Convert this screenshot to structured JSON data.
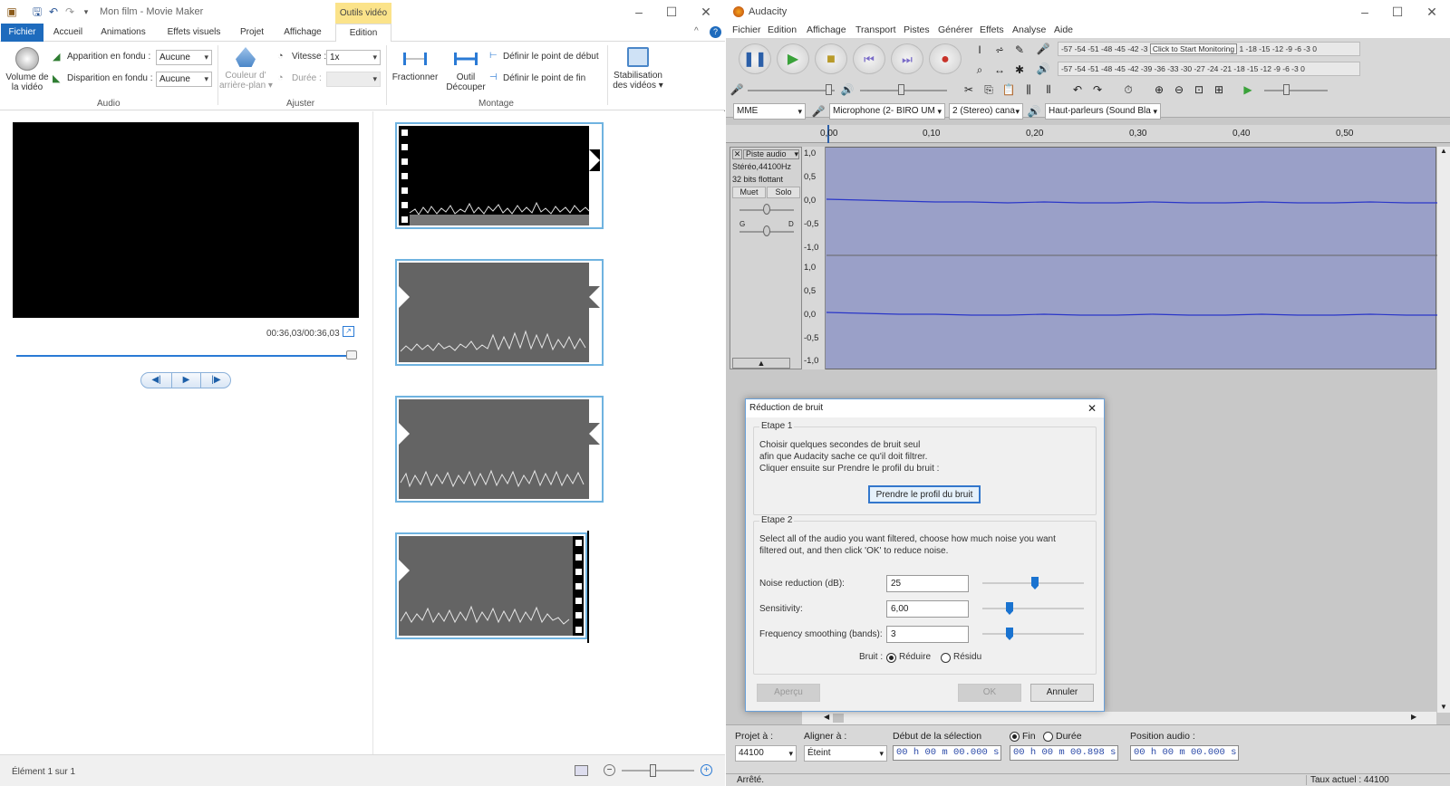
{
  "moviemaker": {
    "title": "Mon film - Movie Maker",
    "contextual_tab": "Outils vidéo",
    "tabs": [
      "Fichier",
      "Accueil",
      "Animations",
      "Effets visuels",
      "Projet",
      "Affichage",
      "Edition"
    ],
    "ribbon": {
      "audio": {
        "group": "Audio",
        "volume_label_1": "Volume de",
        "volume_label_2": "la vidéo",
        "fade_in_label": "Apparition en fondu :",
        "fade_in_value": "Aucune",
        "fade_out_label": "Disparition en fondu :",
        "fade_out_value": "Aucune"
      },
      "adjust": {
        "group": "Ajuster",
        "bgcolor_1": "Couleur d'",
        "bgcolor_2": "arrière-plan ▾",
        "speed_label": "Vitesse :",
        "speed_value": "1x",
        "duration_label": "Durée :"
      },
      "montage": {
        "group": "Montage",
        "split": "Fractionner",
        "trim_1": "Outil",
        "trim_2": "Découper",
        "set_start": "Définir le point de début",
        "set_end": "Définir le point de fin"
      },
      "stab_1": "Stabilisation",
      "stab_2": "des vidéos ▾"
    },
    "timecode": "00:36,03/00:36,03",
    "status": "Élément 1 sur 1"
  },
  "audacity": {
    "title": "Audacity",
    "menu": [
      "Fichier",
      "Edition",
      "Affichage",
      "Transport",
      "Pistes",
      "Générer",
      "Effets",
      "Analyse",
      "Aide"
    ],
    "meter_rec": "-57 -54 -51 -48 -45 -42 -3",
    "meter_monitor": "Click to Start Monitoring",
    "meter_rec_tail": "1 -18 -15 -12  -9  -6  -3  0",
    "meter_play": "-57 -54 -51 -48 -45 -42 -39 -36 -33 -30 -27 -24 -21 -18 -15 -12  -9  -6  -3  0",
    "host": "MME",
    "mic": "Microphone (2- BIRO UM",
    "channels": "2 (Stereo) cana",
    "speakers": "Haut-parleurs (Sound Bla",
    "ruler": [
      "0,00",
      "0,10",
      "0,20",
      "0,30",
      "0,40",
      "0,50"
    ],
    "track": {
      "name": "Piste audio",
      "info1": "Stéréo,44100Hz",
      "info2": "32 bits flottant",
      "mute": "Muet",
      "solo": "Solo",
      "gain_left": "G",
      "gain_right": "D"
    },
    "yaxis": [
      "1,0",
      "0,5",
      "0,0",
      "-0,5",
      "-1,0"
    ],
    "selection": {
      "rate_label": "Projet à :",
      "rate": "44100",
      "snap_label": "Aligner à :",
      "snap": "Éteint",
      "start_label": "Début de la sélection",
      "start": "00 h 00 m 00.000 s",
      "end_label": "Fin",
      "dur_label": "Durée",
      "end": "00 h 00 m 00.898 s",
      "pos_label": "Position audio :",
      "pos": "00 h 00 m 00.000 s"
    },
    "status_left": "Arrêté.",
    "status_right": "Taux actuel : 44100"
  },
  "dialog": {
    "title": "Réduction de bruit",
    "step1": "Etape 1",
    "step1_text_1": "Choisir quelques secondes de bruit seul",
    "step1_text_2": "afin que Audacity sache ce qu'il doit filtrer.",
    "step1_text_3": "Cliquer ensuite sur Prendre le profil du bruit :",
    "profile_button": "Prendre le profil du bruit",
    "step2": "Etape 2",
    "step2_text_1": "Select all of the audio you want filtered, choose how much noise you want",
    "step2_text_2": "filtered out, and then click 'OK' to reduce noise.",
    "nr_label": "Noise reduction (dB):",
    "nr_value": "25",
    "sens_label": "Sensitivity:",
    "sens_value": "6,00",
    "smooth_label": "Frequency smoothing (bands):",
    "smooth_value": "3",
    "noise_label": "Bruit :",
    "opt_reduce": "Réduire",
    "opt_residue": "Résidu",
    "preview": "Aperçu",
    "ok": "OK",
    "cancel": "Annuler"
  }
}
